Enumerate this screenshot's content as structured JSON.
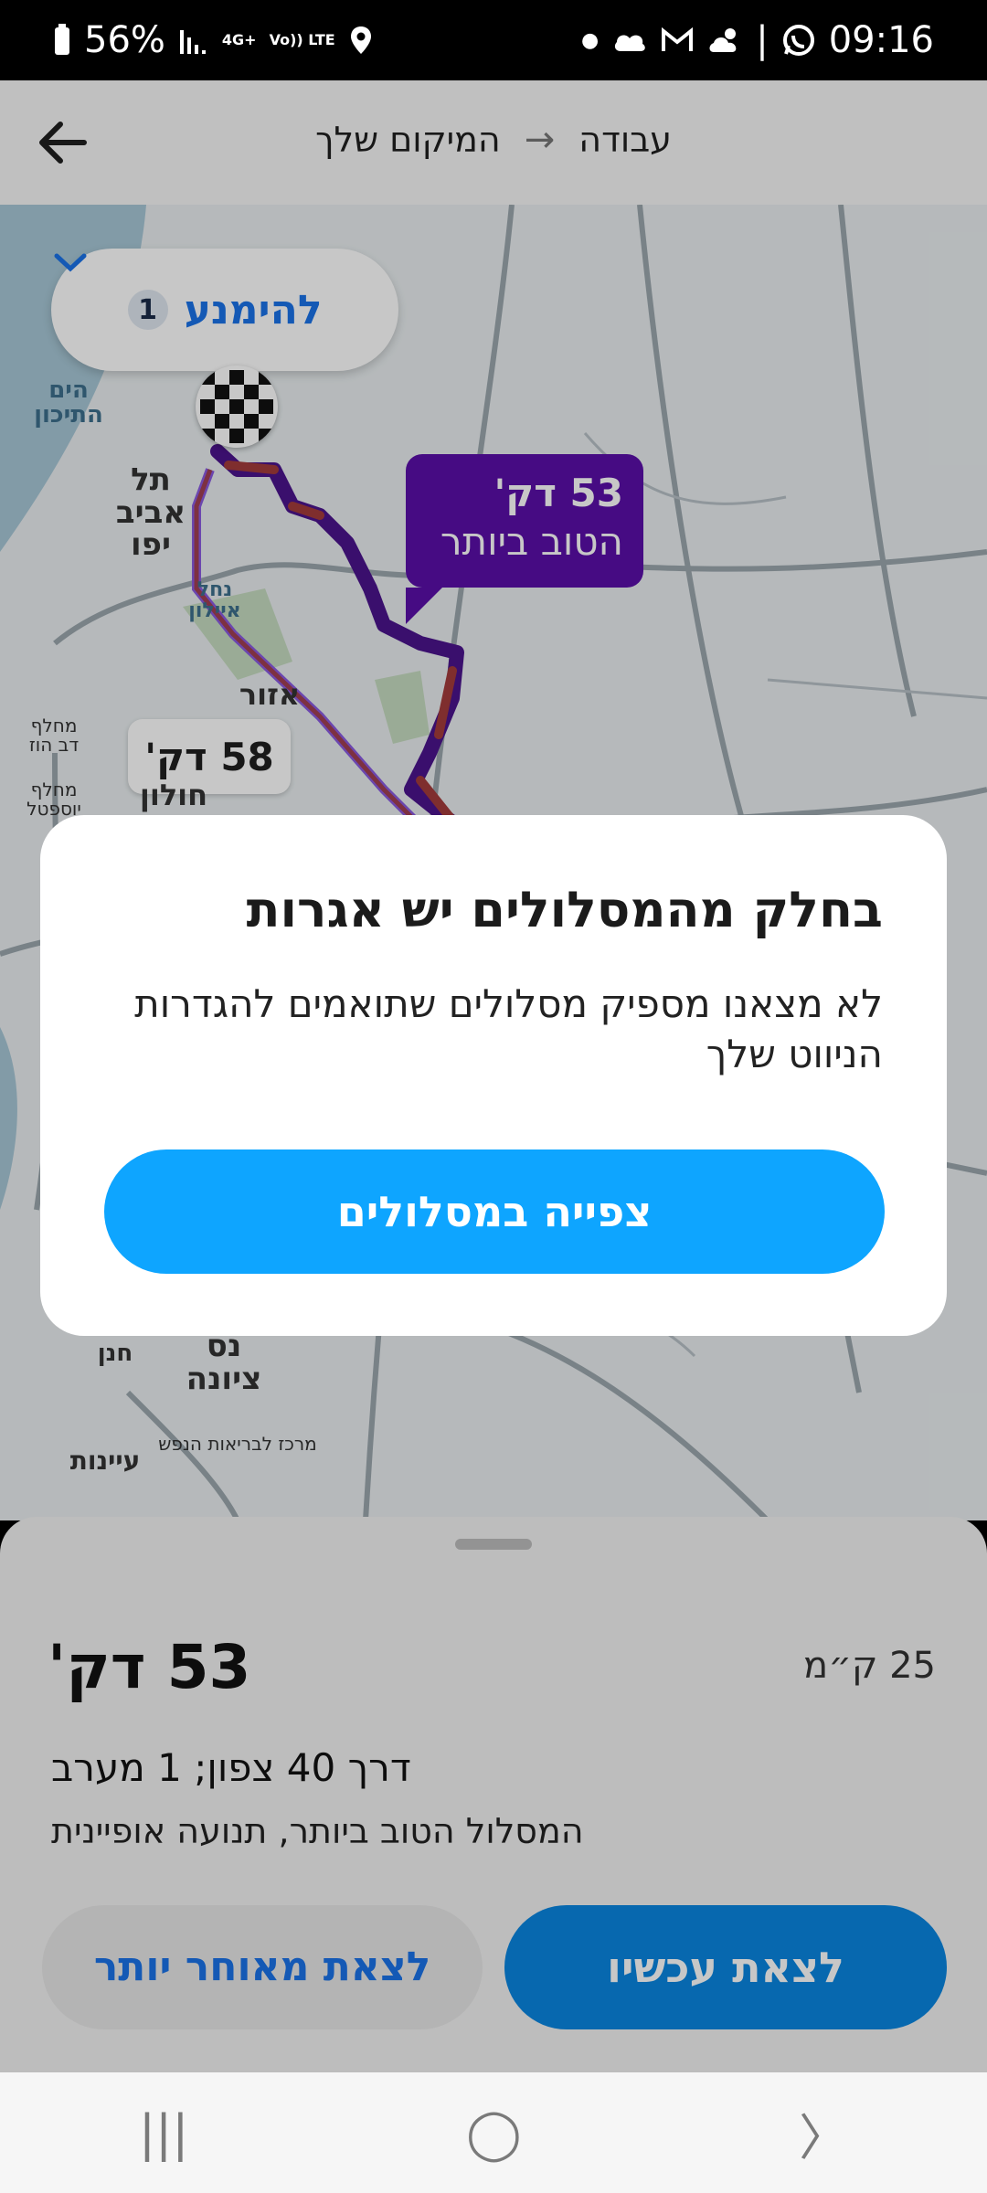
{
  "status_bar": {
    "battery": "56%",
    "network_small_top": "4G+",
    "volte": "Vo)) LTE",
    "time": "09:16"
  },
  "app_bar": {
    "from": "עבודה",
    "arrow": "→",
    "to": "המיקום שלך"
  },
  "map": {
    "avoid_pill": {
      "count": "1",
      "label": "להימנע"
    },
    "best_route_bubble": {
      "time": "53 דק'",
      "label": "הטוב ביותר"
    },
    "alt_route_bubble": {
      "time": "58 דק'"
    },
    "labels": {
      "sea": "הים התיכון",
      "tel_aviv": "תל אביב יפו",
      "nahal_ayalon": "נחל איילון",
      "azor": "אזור",
      "holon": "חולון",
      "interchange_1": "מחלף דב הוז",
      "interchange_2": "מחלף יוספטל",
      "nes_ziona": "נס ציונה",
      "mental_health": "מרכז לבריאות הנפש",
      "ayanot": "עיינות",
      "hanan": "חנן"
    },
    "colors": {
      "best_route": "#4b148c",
      "traffic": "#a33b3b",
      "alt_route": "#8a5ae0"
    }
  },
  "dialog": {
    "title": "בחלק מהמסלולים יש אגרות",
    "body": "לא מצאנו מספיק מסלולים שתואמים להגדרות הניווט שלך",
    "primary_button": "צפייה במסלולים"
  },
  "sheet": {
    "eta": "53 דק'",
    "distance": "25 ק״מ",
    "via": "דרך 40 צפון; 1 מערב",
    "description": "המסלול הטוב ביותר, תנועה אופיינית",
    "later_button": "לצאת מאוחר יותר",
    "now_button": "לצאת עכשיו"
  },
  "nav_bar": {
    "recents": "|||",
    "home": "◯",
    "back": "〉"
  }
}
